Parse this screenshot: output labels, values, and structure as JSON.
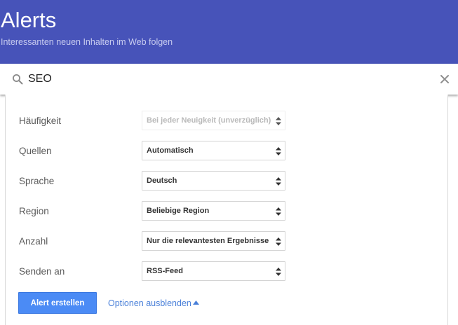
{
  "header": {
    "title": "Alerts",
    "subtitle": "Interessanten neuen Inhalten im Web folgen",
    "background_color": "#4753b9"
  },
  "search": {
    "value": "SEO",
    "icon": "search-icon",
    "clear_icon": "close-icon"
  },
  "options": [
    {
      "key": "frequency",
      "label": "Häufigkeit",
      "value": "Bei jeder Neuigkeit (unverzüglich)",
      "disabled": true
    },
    {
      "key": "sources",
      "label": "Quellen",
      "value": "Automatisch",
      "disabled": false
    },
    {
      "key": "language",
      "label": "Sprache",
      "value": "Deutsch",
      "disabled": false
    },
    {
      "key": "region",
      "label": "Region",
      "value": "Beliebige Region",
      "disabled": false
    },
    {
      "key": "amount",
      "label": "Anzahl",
      "value": "Nur die relevantesten Ergebnisse",
      "disabled": false
    },
    {
      "key": "deliver_to",
      "label": "Senden an",
      "value": "RSS-Feed",
      "disabled": false
    }
  ],
  "actions": {
    "create_label": "Alert erstellen",
    "toggle_options_label": "Optionen ausblenden",
    "accent_color": "#4b8bf5",
    "link_color": "#4a80d9"
  }
}
